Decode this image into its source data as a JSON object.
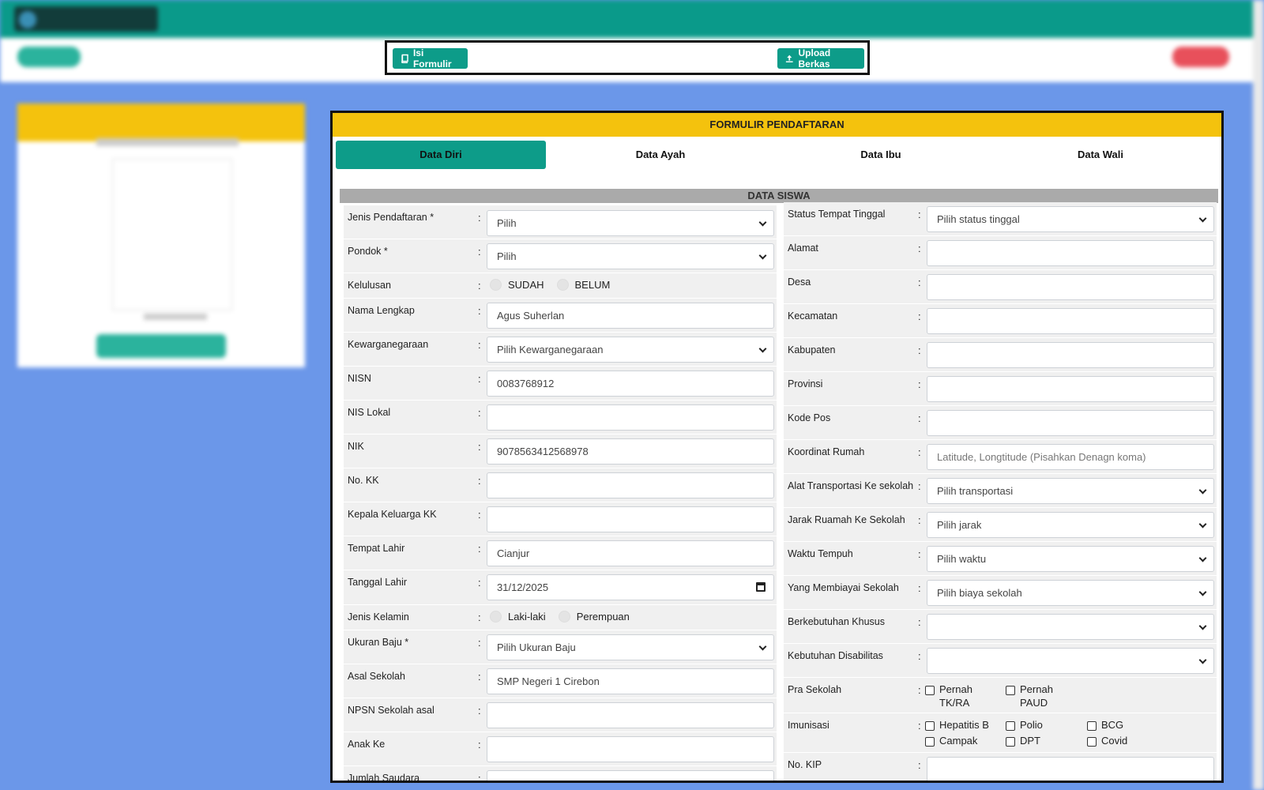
{
  "toolbar": {
    "isi_formulir": "Isi Formulir",
    "upload_berkas": "Upload Berkas"
  },
  "form": {
    "title": "FORMULIR PENDAFTARAN",
    "tabs": [
      "Data Diri",
      "Data Ayah",
      "Data Ibu",
      "Data Wali"
    ],
    "active_tab": "Data Diri",
    "section_title": "DATA SISWA",
    "left": {
      "jenis_pendaftaran": {
        "label": "Jenis Pendaftaran *",
        "value": "Pilih"
      },
      "pondok": {
        "label": "Pondok *",
        "value": "Pilih"
      },
      "kelulusan": {
        "label": "Kelulusan",
        "options": [
          "SUDAH",
          "BELUM"
        ]
      },
      "nama_lengkap": {
        "label": "Nama Lengkap",
        "value": "Agus Suherlan"
      },
      "kewarganegaraan": {
        "label": "Kewarganegaraan",
        "value": "Pilih Kewarganegaraan"
      },
      "nisn": {
        "label": "NISN",
        "value": "0083768912"
      },
      "nis_lokal": {
        "label": "NIS Lokal",
        "value": ""
      },
      "nik": {
        "label": "NIK",
        "value": "9078563412568978"
      },
      "no_kk": {
        "label": "No. KK",
        "value": ""
      },
      "kepala_keluarga": {
        "label": "Kepala Keluarga KK",
        "value": ""
      },
      "tempat_lahir": {
        "label": "Tempat Lahir",
        "value": "Cianjur"
      },
      "tanggal_lahir": {
        "label": "Tanggal Lahir",
        "value": "31/12/2025"
      },
      "jenis_kelamin": {
        "label": "Jenis Kelamin",
        "options": [
          "Laki-laki",
          "Perempuan"
        ]
      },
      "ukuran_baju": {
        "label": "Ukuran Baju *",
        "value": "Pilih Ukuran Baju"
      },
      "asal_sekolah": {
        "label": "Asal Sekolah",
        "value": "SMP Negeri 1 Cirebon"
      },
      "npsn": {
        "label": "NPSN Sekolah asal",
        "value": ""
      },
      "anak_ke": {
        "label": "Anak Ke",
        "value": ""
      },
      "jumlah_saudara": {
        "label": "Jumlah Saudara",
        "value": ""
      }
    },
    "right": {
      "status_tinggal": {
        "label": "Status Tempat Tinggal",
        "value": "Pilih status tinggal"
      },
      "alamat": {
        "label": "Alamat",
        "value": ""
      },
      "desa": {
        "label": "Desa",
        "value": ""
      },
      "kecamatan": {
        "label": "Kecamatan",
        "value": ""
      },
      "kabupaten": {
        "label": "Kabupaten",
        "value": ""
      },
      "provinsi": {
        "label": "Provinsi",
        "value": ""
      },
      "kode_pos": {
        "label": "Kode Pos",
        "value": ""
      },
      "koordinat": {
        "label": "Koordinat Rumah",
        "placeholder": "Latitude, Longtitude (Pisahkan Denagn koma)"
      },
      "transportasi": {
        "label": "Alat Transportasi Ke sekolah",
        "value": "Pilih transportasi"
      },
      "jarak": {
        "label": "Jarak Ruamah Ke Sekolah",
        "value": "Pilih jarak"
      },
      "waktu": {
        "label": "Waktu Tempuh",
        "value": "Pilih waktu"
      },
      "biaya": {
        "label": "Yang Membiayai Sekolah",
        "value": "Pilih biaya sekolah"
      },
      "berkebutuhan": {
        "label": "Berkebutuhan Khusus",
        "value": ""
      },
      "disabilitas": {
        "label": "Kebutuhan Disabilitas",
        "value": ""
      },
      "pra_sekolah": {
        "label": "Pra Sekolah",
        "options": [
          "Pernah TK/RA",
          "Pernah PAUD"
        ]
      },
      "imunisasi": {
        "label": "Imunisasi",
        "options": [
          "Hepatitis B",
          "Polio",
          "BCG",
          "Campak",
          "DPT",
          "Covid"
        ]
      },
      "no_kip": {
        "label": "No. KIP",
        "value": ""
      }
    },
    "colon": ":"
  },
  "colors": {
    "teal": "#0d9c89",
    "yellow": "#f4c20d",
    "background": "#6b97e9"
  }
}
